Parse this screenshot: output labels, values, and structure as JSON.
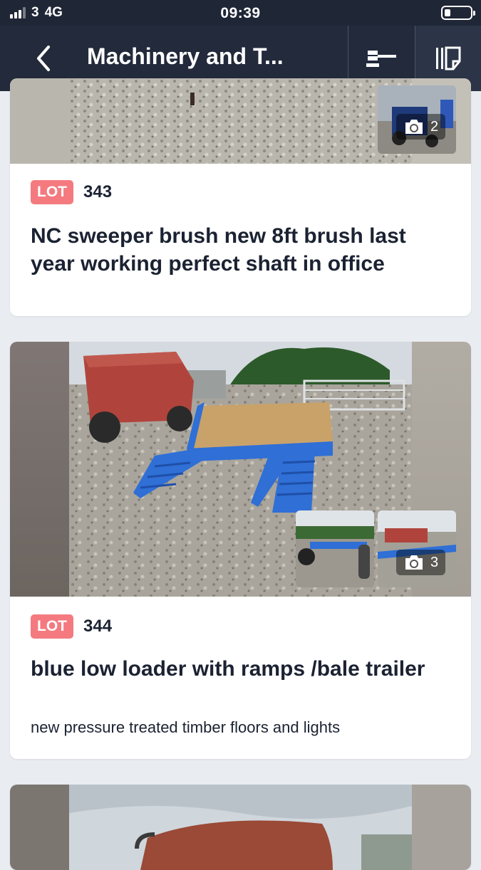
{
  "status": {
    "carrier": "3",
    "network": "4G",
    "time": "09:39"
  },
  "nav": {
    "title": "Machinery and T...",
    "icons": [
      "chevron-left-icon",
      "gavel-icon",
      "catalogue-icon"
    ]
  },
  "lots": [
    {
      "badge": "LOT",
      "number": "343",
      "title": "NC sweeper brush new 8ft brush last year working perfect shaft in office",
      "photo_count": "2"
    },
    {
      "badge": "LOT",
      "number": "344",
      "title": "blue low loader with ramps /bale trailer",
      "description": "new pressure treated timber floors and lights",
      "photo_count": "3"
    }
  ],
  "colors": {
    "header": "#222a3b",
    "status_bar": "#1f2636",
    "lot_badge": "#f47a7f",
    "background": "#e9ecf1",
    "trailer_blue": "#2f6fd6"
  }
}
